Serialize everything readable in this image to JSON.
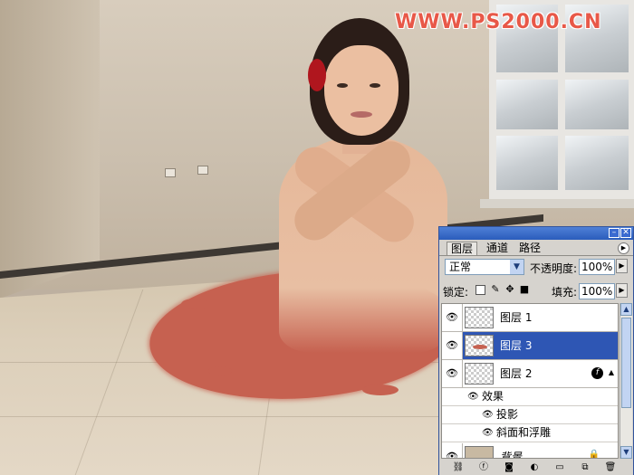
{
  "watermark": "WWW.PS2000.CN",
  "colors": {
    "puddle": "#c66150",
    "selection": "#2e56b4",
    "titlebar": "#2a5cbc"
  },
  "panel": {
    "tabs": [
      {
        "label": "图层",
        "active": true
      },
      {
        "label": "通道",
        "active": false
      },
      {
        "label": "路径",
        "active": false
      }
    ],
    "blend_mode": "正常",
    "opacity_label": "不透明度:",
    "opacity_value": "100%",
    "lock_label": "锁定:",
    "fill_label": "填充:",
    "fill_value": "100%",
    "layers": [
      {
        "name": "图层 1",
        "selected": false
      },
      {
        "name": "图层 3",
        "selected": true
      },
      {
        "name": "图层 2",
        "selected": false,
        "has_effects": true
      },
      {
        "name": "背景",
        "selected": false,
        "locked": true
      }
    ],
    "effects_label": "效果",
    "effects": [
      "投影",
      "斜面和浮雕"
    ],
    "icons": {
      "eye": "eye-icon",
      "fx": "fx-icon",
      "lock": "lock-icon",
      "link": "link-icon",
      "new_layer": "new-layer-icon",
      "trash": "trash-icon"
    }
  }
}
